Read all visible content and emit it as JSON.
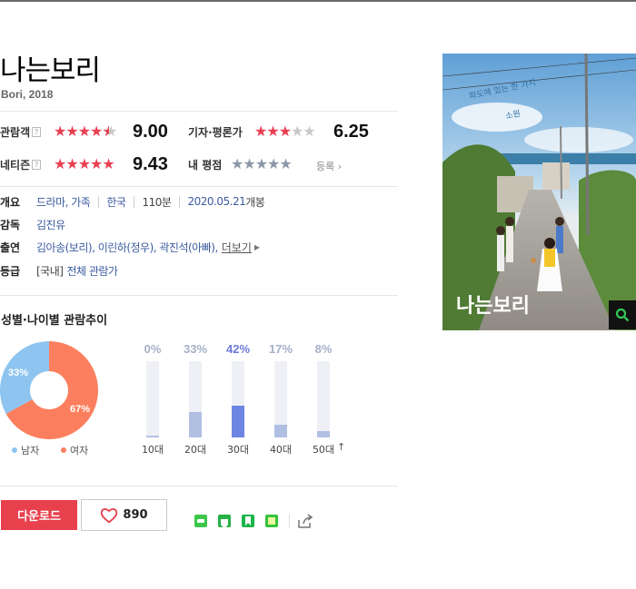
{
  "movie": {
    "title": "나는보리",
    "subtitle": "Bori, 2018"
  },
  "ratings": {
    "audience": {
      "label": "관람객",
      "help": "?",
      "score": "9.00",
      "stars": 4.5
    },
    "critic": {
      "label": "기자·평론가",
      "score": "6.25",
      "stars": 3
    },
    "netizen": {
      "label": "네티즌",
      "help": "?",
      "score": "9.43",
      "stars": 5
    },
    "mine": {
      "label": "내 평점",
      "register": "등록",
      "stars": 0
    }
  },
  "info": {
    "overview": {
      "key": "개요",
      "genre": "드라마, 가족",
      "country": "한국",
      "runtime": "110분",
      "release_date": "2020.05.21",
      "release_suffix": " 개봉"
    },
    "director": {
      "key": "감독",
      "name": "김진유"
    },
    "cast": {
      "key": "출연",
      "names": "김아송(보리), 이린하(정우), 곽진석(아빠),",
      "more": "더보기"
    },
    "grade": {
      "key": "등급",
      "prefix": "[국내]",
      "value": "전체 관람가"
    }
  },
  "trend": {
    "title": "성별·나이별 관람추이",
    "gender": [
      {
        "name": "남자",
        "percent": 33,
        "label": "33%",
        "color": "#8ec5f0"
      },
      {
        "name": "여자",
        "percent": 67,
        "label": "67%",
        "color": "#fb7f5e"
      }
    ],
    "age": [
      {
        "label": "10대",
        "pct_label": "0%",
        "value": 0.02,
        "highlight": false
      },
      {
        "label": "20대",
        "pct_label": "33%",
        "value": 0.33,
        "highlight": false
      },
      {
        "label": "30대",
        "pct_label": "42%",
        "value": 0.42,
        "highlight": true
      },
      {
        "label": "40대",
        "pct_label": "17%",
        "value": 0.17,
        "highlight": false
      },
      {
        "label": "50대",
        "pct_label": "8%",
        "value": 0.08,
        "highlight": false
      }
    ]
  },
  "actions": {
    "download": "다운로드",
    "like_count": "890"
  },
  "poster": {
    "title": "나는보리",
    "tagline": "파도에 있는 한 가지",
    "tagline2": "소원"
  },
  "icons": {
    "help": "question-box-icon",
    "arrow": "chevron-right-icon",
    "zoom": "magnifier-icon",
    "like": "heart-icon",
    "share": "share-arrow-icon"
  },
  "colors": {
    "accent": "#e8404d",
    "star_on": "#e84052",
    "bar_highlight": "#6d85e3",
    "link": "#3b5a9e"
  }
}
